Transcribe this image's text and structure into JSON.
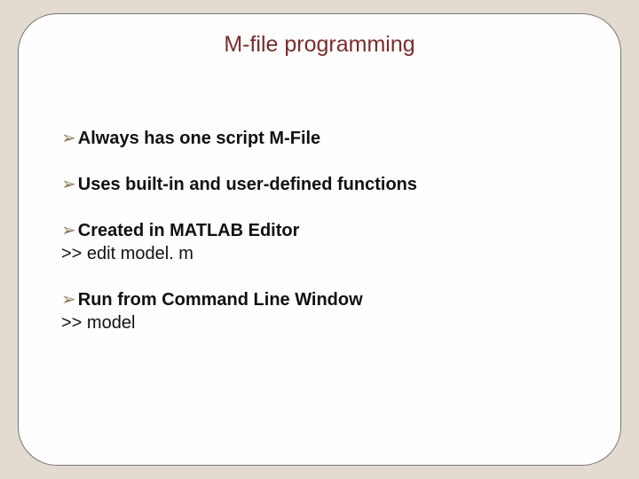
{
  "slide": {
    "title": "M-file programming",
    "items": [
      {
        "label": "Always has one script M-File",
        "code": null
      },
      {
        "label": "Uses built-in and user-defined functions",
        "code": null
      },
      {
        "label": "Created in MATLAB Editor",
        "code": ">> edit model. m"
      },
      {
        "label": "Run from Command Line Window",
        "code": ">> model"
      }
    ],
    "bullet_glyph": "➢"
  }
}
